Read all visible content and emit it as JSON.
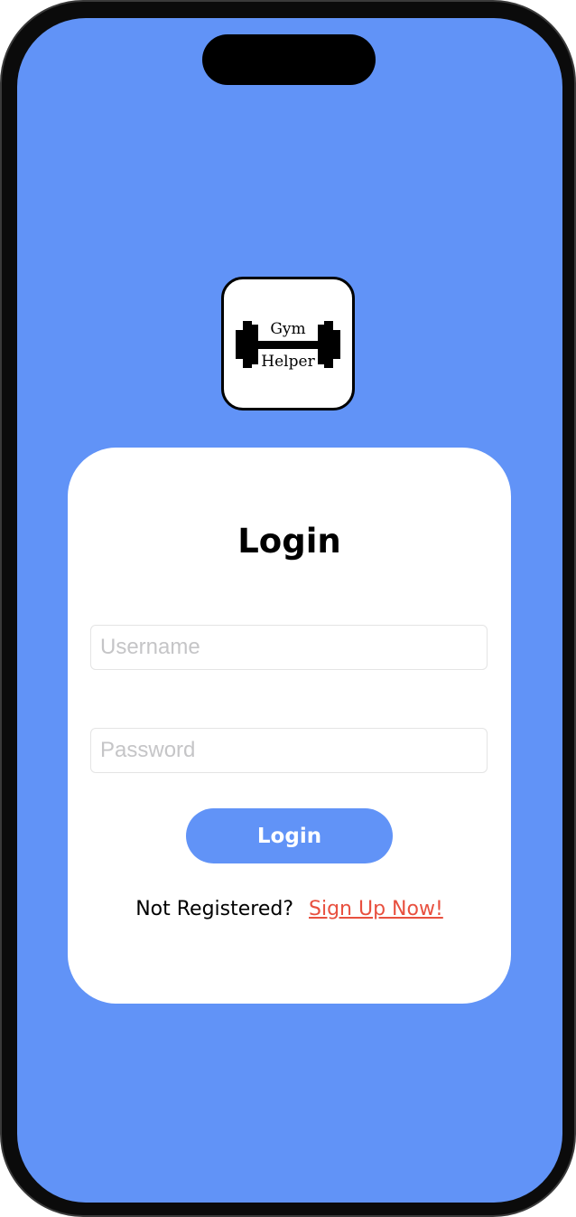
{
  "logo": {
    "line1": "Gym",
    "line2": "Helper",
    "icon": "dumbbell-icon"
  },
  "login": {
    "title": "Login",
    "username_placeholder": "Username",
    "username_value": "",
    "password_placeholder": "Password",
    "password_value": "",
    "button_label": "Login",
    "not_registered_text": "Not Registered?",
    "signup_link_text": "Sign Up Now!"
  },
  "colors": {
    "background": "#6193f7",
    "card": "#ffffff",
    "button": "#6193f7",
    "link": "#e8503f"
  }
}
